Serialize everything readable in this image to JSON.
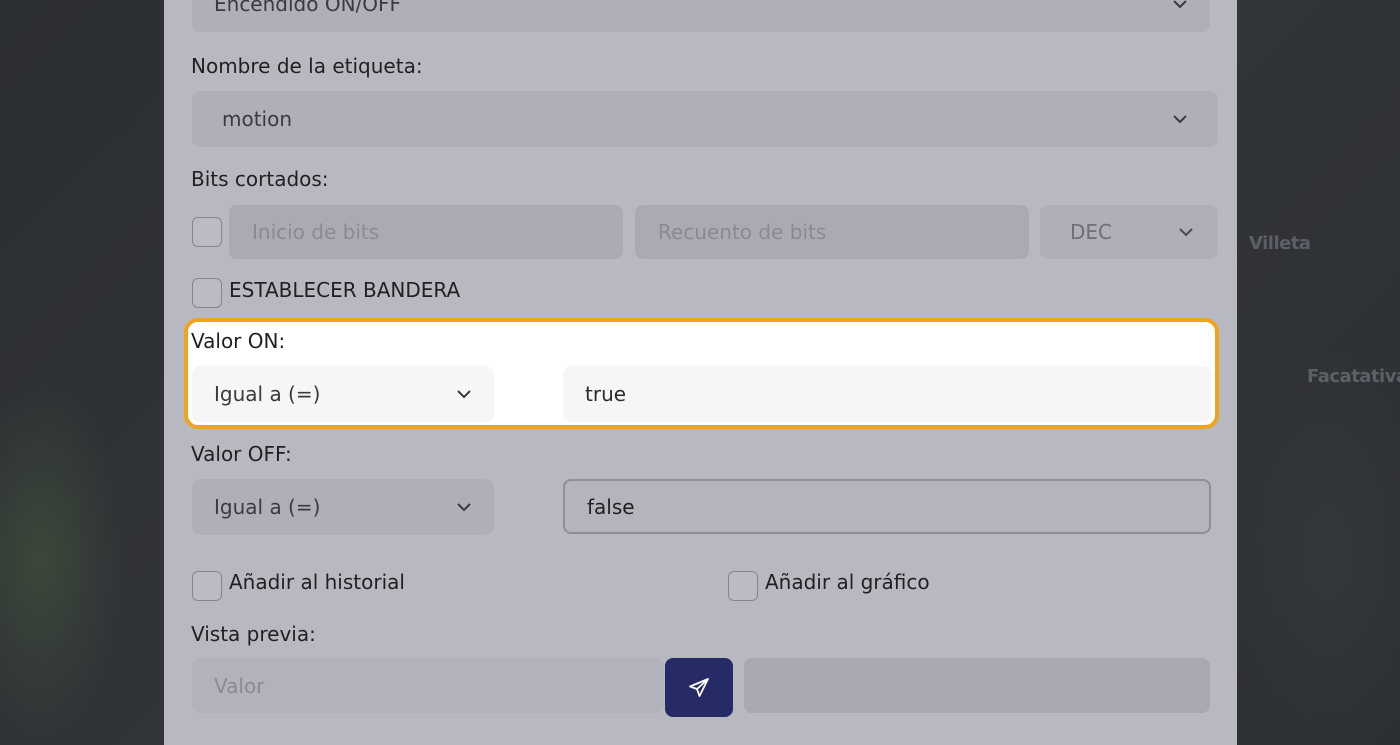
{
  "map": {
    "labels": [
      "Villeta",
      "Facatativá"
    ]
  },
  "form": {
    "top_select_value": "Encendido ON/OFF",
    "tag_name": {
      "label": "Nombre de la etiqueta:",
      "value": "motion"
    },
    "cut_bits": {
      "label": "Bits cortados:",
      "start_placeholder": "Inicio de bits",
      "count_placeholder": "Recuento de bits",
      "format_value": "DEC"
    },
    "set_flag": {
      "label": "ESTABLECER BANDERA",
      "checked": false
    },
    "on_value": {
      "label": "Valor ON:",
      "operator": "Igual a (=)",
      "value": "true"
    },
    "off_value": {
      "label": "Valor OFF:",
      "operator": "Igual a (=)",
      "value": "false"
    },
    "add_history": {
      "label": "Añadir al historial",
      "checked": false
    },
    "add_chart": {
      "label": "Añadir al gráfico",
      "checked": false
    },
    "preview": {
      "label": "Vista previa:",
      "value_placeholder": "Valor",
      "result_value": ""
    }
  },
  "colors": {
    "highlight": "#f0a41c",
    "send_button": "#262b66",
    "modal_bg": "#b8b9c0"
  },
  "icons": {
    "send": "paper-plane-icon",
    "chevron": "chevron-down-icon"
  }
}
